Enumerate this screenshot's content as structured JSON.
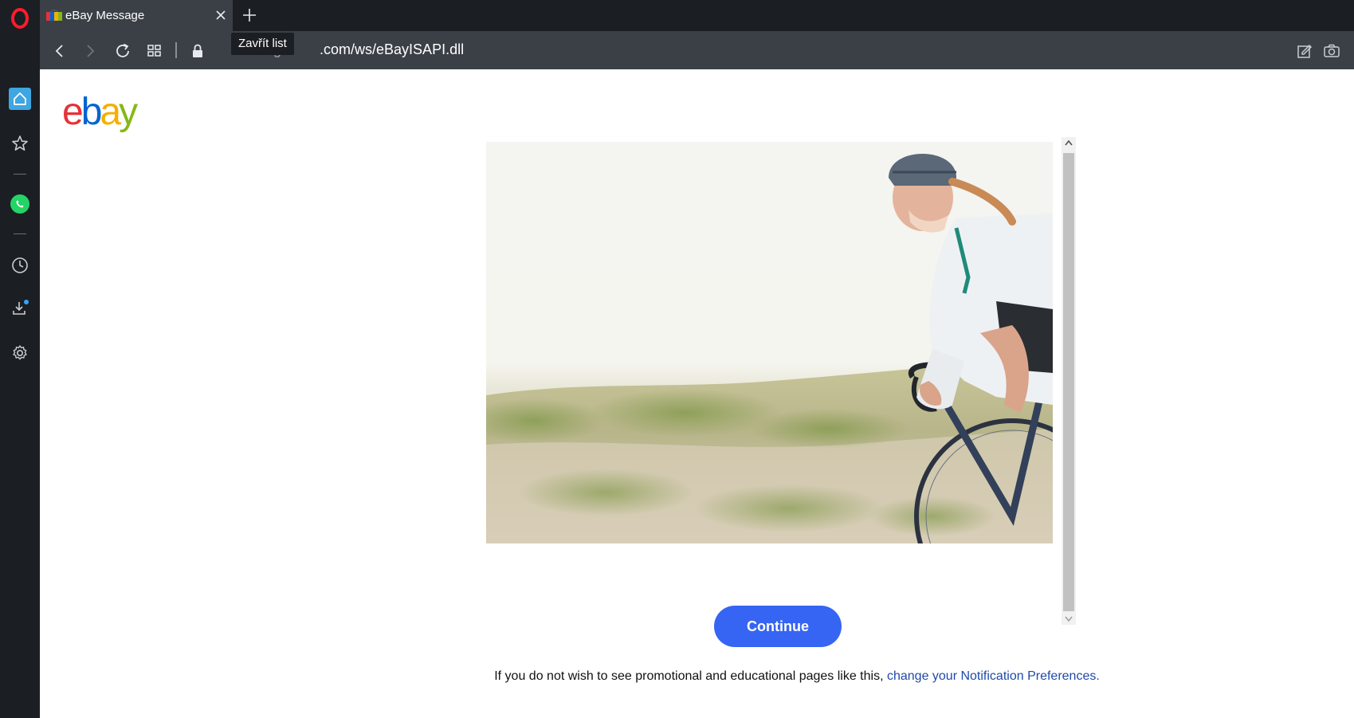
{
  "browser": {
    "tab": {
      "title": "eBay Message",
      "close_icon": "close-icon",
      "favicon": "ebay-favicon"
    },
    "new_tab_icon": "plus-icon",
    "tooltip": "Zavřít list",
    "address_bar": {
      "url_prefix": "sig",
      "url_host": ".com/ws/eBayISAPI.dll"
    },
    "toolbar_icons": [
      "back-icon",
      "forward-icon",
      "reload-icon",
      "tabs-grid-icon",
      "lock-icon",
      "snapshot-edit-icon",
      "camera-icon"
    ]
  },
  "sidebar": {
    "items": [
      {
        "name": "opera-logo-icon"
      },
      {
        "name": "home-icon"
      },
      {
        "name": "bookmarks-icon"
      },
      {
        "name": "whatsapp-icon"
      },
      {
        "name": "history-icon"
      },
      {
        "name": "downloads-icon"
      },
      {
        "name": "settings-icon"
      }
    ]
  },
  "page": {
    "logo": {
      "letters": [
        "e",
        "b",
        "a",
        "y"
      ],
      "colors": [
        "#e53238",
        "#0064d2",
        "#f5af02",
        "#86b817"
      ]
    },
    "continue_label": "Continue",
    "footnote_text": "If you do not wish to see promotional and educational pages like this, ",
    "footnote_link": "change your Notification Preferences."
  },
  "colors": {
    "accent": "#3665f3",
    "link": "#1f4aa8",
    "chrome_dark": "#1b1e22",
    "chrome_mid": "#3b4047"
  }
}
